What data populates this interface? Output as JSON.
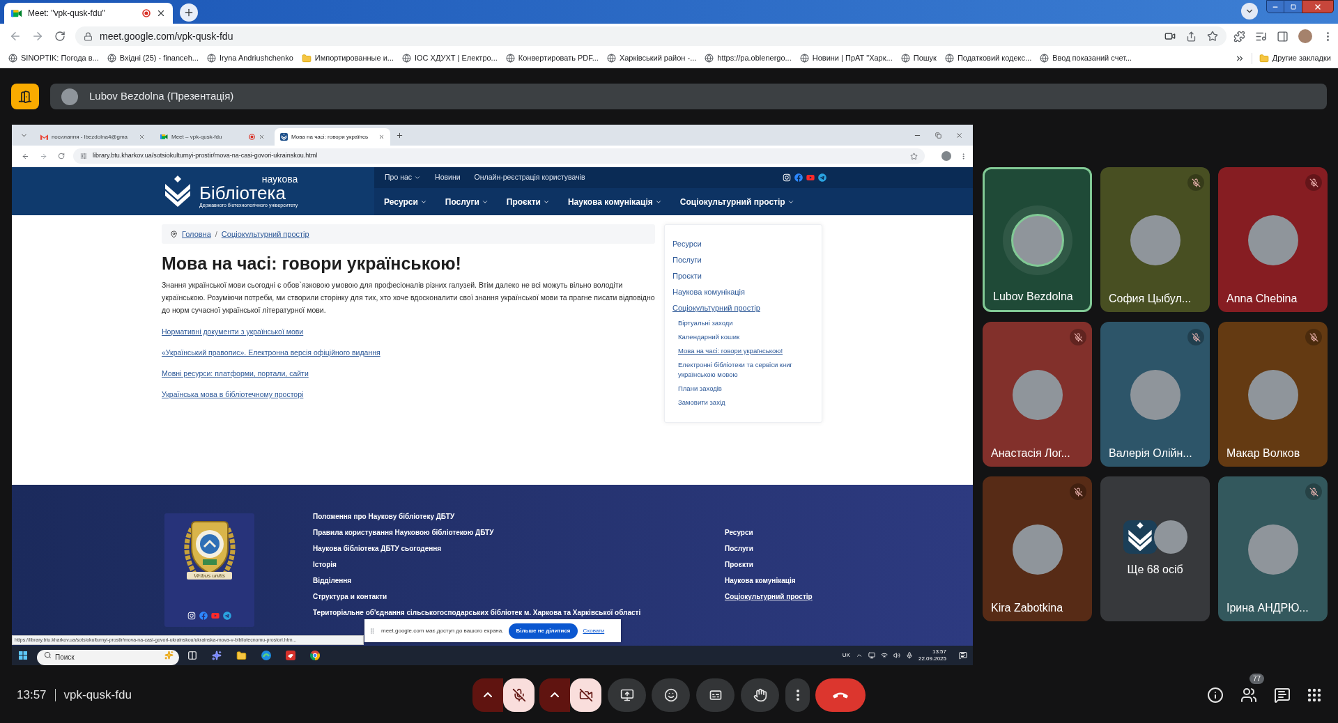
{
  "browser": {
    "tabs": [
      {
        "title": "Meet: \"vpk-qusk-fdu\"",
        "selected": true,
        "recording": true
      }
    ],
    "address": "meet.google.com/vpk-qusk-fdu",
    "bookmarks": [
      {
        "label": "SINOPTIK: Погода в...",
        "kind": "site"
      },
      {
        "label": "Вхідні (25) - financeh...",
        "kind": "site"
      },
      {
        "label": "Iryna Andriushchenko",
        "kind": "site"
      },
      {
        "label": "Импортированные и...",
        "kind": "folder"
      },
      {
        "label": "ІОС ХДУХТ | Електро...",
        "kind": "site"
      },
      {
        "label": "Конвертировать PDF...",
        "kind": "site"
      },
      {
        "label": "Харківський район -...",
        "kind": "site"
      },
      {
        "label": "https://pa.oblenergo...",
        "kind": "site"
      },
      {
        "label": "Новини | ПрАТ \"Харк...",
        "kind": "site"
      },
      {
        "label": "Пошук",
        "kind": "site"
      },
      {
        "label": "Податковий кодекс...",
        "kind": "site"
      },
      {
        "label": "Ввод показаний счет...",
        "kind": "site"
      }
    ],
    "other_bookmarks": {
      "label": "Другие закладки",
      "kind": "folder"
    }
  },
  "presentation": {
    "label": "Lubov Bezdolna (Презентація)"
  },
  "shared_screen": {
    "tabs": [
      {
        "title": "посилання - lbezdolna4@gma",
        "kind": "mail",
        "selected": false,
        "recording": false
      },
      {
        "title": "Meet – vpk-qusk-fdu",
        "kind": "video",
        "selected": false,
        "recording": true
      },
      {
        "title": "Мова на часі: говори українсь",
        "kind": "library",
        "selected": true,
        "recording": false
      }
    ],
    "address": "library.btu.kharkov.ua/sotsiokulturnyi-prostir/mova-na-casi-govori-ukrainskou.html",
    "site": {
      "logo": {
        "top": "наукова",
        "main": "Бібліотека",
        "subtitle": "Державного біотехнологічного університету"
      },
      "top_nav": [
        {
          "label": "Про нас",
          "dropdown": true
        },
        {
          "label": "Новини",
          "dropdown": false
        },
        {
          "label": "Онлайн-реєстрація користувачів",
          "dropdown": false
        }
      ],
      "main_nav": [
        {
          "label": "Ресурси",
          "dropdown": true
        },
        {
          "label": "Послуги",
          "dropdown": true
        },
        {
          "label": "Проєкти",
          "dropdown": true
        },
        {
          "label": "Наукова комунікація",
          "dropdown": true
        },
        {
          "label": "Соціокультурний простір",
          "dropdown": true
        }
      ]
    },
    "page": {
      "breadcrumb": {
        "items": [
          "Головна",
          "Соціокультурний простір"
        ],
        "separator": "/"
      },
      "title": "Мова на часі: говори українською!",
      "intro": "Знання української мови сьогодні є обов`язковою умовою для професіоналів різних галузей. Втім далеко не всі можуть вільно володіти українською. Розуміючи потреби, ми створили сторінку для тих, хто хоче вдосконалити свої знання української мови та прагне писати відповідно до норм сучасної української літературної мови.",
      "links": [
        "Нормативні документи з української мови",
        "«Український правопис». Електронна версія офіційного видання",
        "Мовні ресурси: платформи, портали, сайти",
        "Українська мова в бібліотечному просторі"
      ],
      "sidebar": [
        {
          "label": "Ресурси",
          "selected": false
        },
        {
          "label": "Послуги",
          "selected": false
        },
        {
          "label": "Проєкти",
          "selected": false
        },
        {
          "label": "Наукова комунікація",
          "selected": false
        },
        {
          "label": "Соціокультурний простір",
          "selected": true,
          "children": [
            {
              "label": "Віртуальні заходи",
              "selected": false
            },
            {
              "label": "Календарний кошик",
              "selected": false
            },
            {
              "label": "Мова на часі: говори українською!",
              "selected": true
            },
            {
              "label": "Електронні бібліотеки та сервіси книг українською мовою",
              "selected": false
            },
            {
              "label": "Плани заходів",
              "selected": false
            },
            {
              "label": "Замовити захід",
              "selected": false
            }
          ]
        }
      ]
    },
    "footer": {
      "motto": "Viribus unitis",
      "links": [
        "Положення про Наукову бібліотеку ДБТУ",
        "Правила користування Науковою бібліотекою ДБТУ",
        "Наукова бібліотека ДБТУ сьогодення",
        "Історія",
        "Відділення",
        "Структура и контакти",
        "Територіальне об'єднання сільськогосподарських бібліотек м. Харкова та Харківської області"
      ],
      "menu": [
        {
          "label": "Ресурси",
          "selected": false
        },
        {
          "label": "Послуги",
          "selected": false
        },
        {
          "label": "Проєкти",
          "selected": false
        },
        {
          "label": "Наукова комунікація",
          "selected": false
        },
        {
          "label": "Соціокультурний простір",
          "selected": true
        }
      ]
    },
    "status_url": "https://library.btu.kharkov.ua/sotsiokulturnyi-prostir/mova-na-casi-govori-ukrainskou/ukrainska-mova-v-bibliotecnomu-prostori.htm...",
    "share_notice": {
      "text": "meet.google.com має доступ до вашого екрана.",
      "stop_button": "Більше не ділитися",
      "hide_link": "Сховати"
    },
    "taskbar": {
      "search": {
        "placeholder": "Поиск"
      },
      "language": "UK",
      "time": "13:57",
      "date": "22.09.2025"
    }
  },
  "participant_rows": [
    [
      {
        "kind": "person",
        "name": "Lubov Bezdolna",
        "speaking": true,
        "muted": false,
        "color": "#1f4a37"
      },
      {
        "kind": "person",
        "name": "София Цыбул...",
        "speaking": false,
        "muted": true,
        "color": "#484f22"
      },
      {
        "kind": "person",
        "name": "Anna Chebina",
        "speaking": false,
        "muted": true,
        "color": "#861d22"
      }
    ],
    [
      {
        "kind": "person",
        "name": "Анастасія Лог...",
        "speaking": false,
        "muted": true,
        "color": "#82302b"
      },
      {
        "kind": "person",
        "name": "Валерія Олійн...",
        "speaking": false,
        "muted": true,
        "color": "#2d5569"
      },
      {
        "kind": "person",
        "name": "Макар Волков",
        "speaking": false,
        "muted": true,
        "color": "#643a12"
      }
    ],
    [
      {
        "kind": "person",
        "name": "Kira Zabotkina",
        "speaking": false,
        "muted": true,
        "color": "#572b16"
      },
      {
        "kind": "more",
        "label": "Ще 68 осіб",
        "speaking": false,
        "muted": false,
        "color": "#37393c"
      },
      {
        "kind": "person",
        "name": "Ірина АНДРЮ...",
        "speaking": false,
        "muted": true,
        "color": "#33585d"
      }
    ]
  ],
  "meeting": {
    "time": "13:57",
    "code": "vpk-qusk-fdu",
    "people_count": "77"
  },
  "controls": {
    "mic_on": false,
    "camera_on": false
  }
}
